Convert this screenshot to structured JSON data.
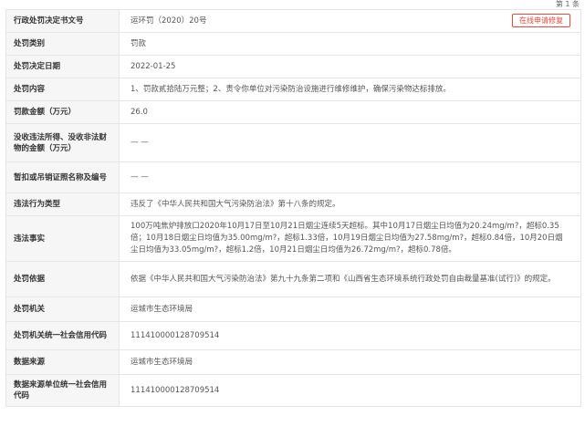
{
  "page_count": "第 1 条",
  "repair_button": "在线申请修复",
  "rows": [
    {
      "key": "行政处罚决定书文号",
      "value": "运环罚（2020）20号"
    },
    {
      "key": "处罚类别",
      "value": "罚款"
    },
    {
      "key": "处罚决定日期",
      "value": "2022-01-25"
    },
    {
      "key": "处罚内容",
      "value": "1、罚款贰拾陆万元整；2、责令你单位对污染防治设施进行维修维护，确保污染物达标排放。"
    },
    {
      "key": "罚款金额（万元）",
      "value": "26.0"
    },
    {
      "key": "没收违法所得、没收非法财物的金额（万元）",
      "value": "— —"
    },
    {
      "key": "暂扣或吊销证照名称及编号",
      "value": "— —"
    },
    {
      "key": "违法行为类型",
      "value": "违反了《中华人民共和国大气污染防治法》第十八条的规定。"
    },
    {
      "key": "违法事实",
      "value": "100万吨焦炉排放口2020年10月17日至10月21日烟尘连续5天超标。其中10月17日烟尘日均值为20.24mg/m?，超标0.35倍；10月18日烟尘日均值为35.00mg/m?，超标1.33倍，10月19日烟尘日均值为27.58mg/m?，超标0.84倍，10月20日烟尘日均值为33.05mg/m?，超标1.2倍，10月21日烟尘日均值为26.72mg/m?，超标0.78倍。"
    },
    {
      "key": "处罚依据",
      "value": "依据《中华人民共和国大气污染防治法》第九十九条第二项和《山西省生态环境系统行政处罚自由裁量基准(试行)》的规定。"
    },
    {
      "key": "处罚机关",
      "value": "运城市生态环境局"
    },
    {
      "key": "处罚机关统一社会信用代码",
      "value": "111410000128709514"
    },
    {
      "key": "数据来源",
      "value": "运城市生态环境局"
    },
    {
      "key": "数据来源单位统一社会信用代码",
      "value": "111410000128709514"
    }
  ]
}
